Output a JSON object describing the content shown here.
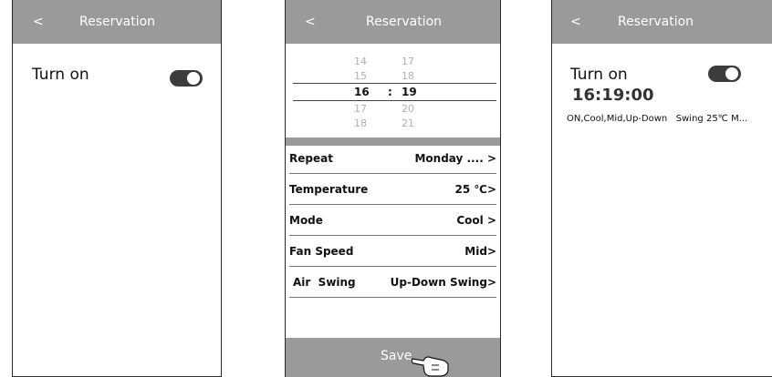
{
  "screen1": {
    "back": "<",
    "title": "Reservation",
    "turn_on_label": "Turn on"
  },
  "screen2": {
    "back": "<",
    "title": "Reservation",
    "picker": {
      "rows": [
        {
          "hour": "14",
          "minute": "17"
        },
        {
          "hour": "15",
          "minute": "18"
        },
        {
          "hour": "16",
          "minute": "19"
        },
        {
          "hour": "17",
          "minute": "20"
        },
        {
          "hour": "18",
          "minute": "21"
        }
      ],
      "separator": ":"
    },
    "settings": [
      {
        "label": "Repeat",
        "value": "Monday .... >"
      },
      {
        "label": "Temperature",
        "value": "25 ℃>"
      },
      {
        "label": "Mode",
        "value": "Cool >"
      },
      {
        "label": "Fan Speed",
        "value": "Mid>"
      },
      {
        "label": "Air  Swing",
        "value": "Up-Down Swing>"
      }
    ],
    "save_label": "Save"
  },
  "screen3": {
    "back": "<",
    "title": "Reservation",
    "turn_on_label": "Turn on",
    "time": "16:19:00",
    "summary": "ON,Cool,Mid,Up-Down   Swing 25℃ M..."
  }
}
